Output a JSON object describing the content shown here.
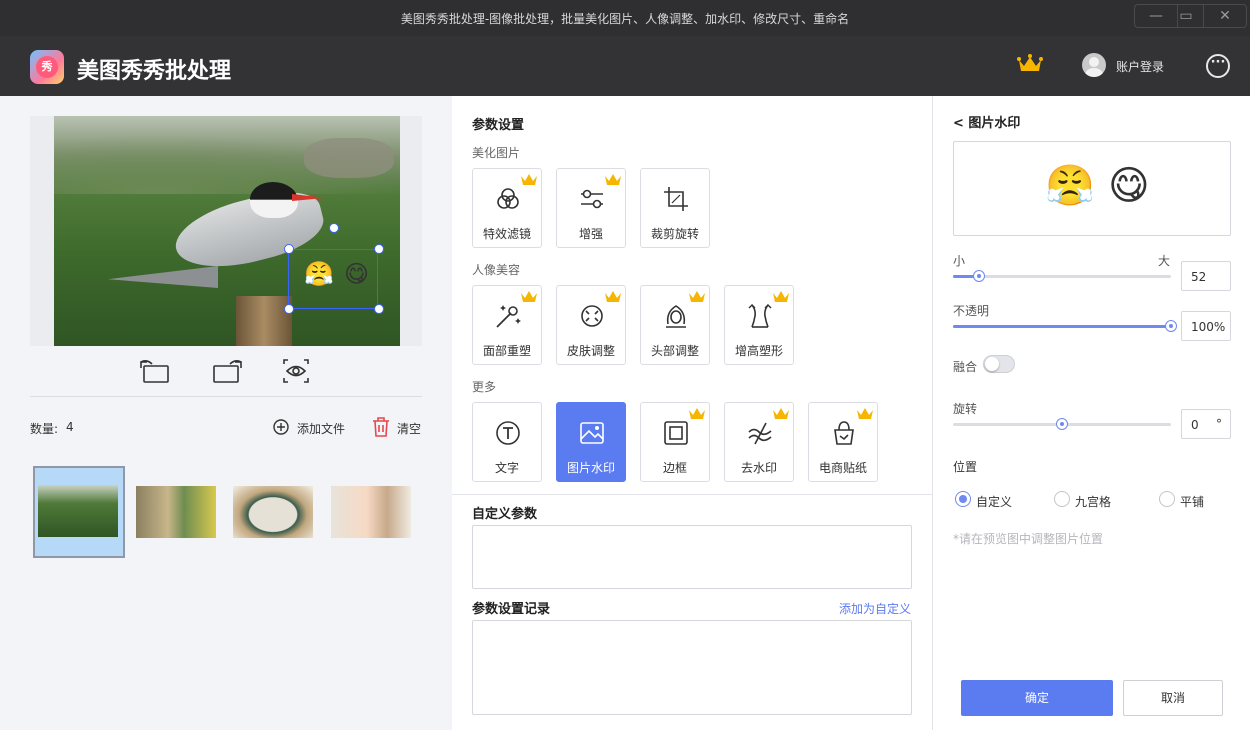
{
  "window": {
    "title": "美图秀秀批处理-图像批处理，批量美化图片、人像调整、加水印、修改尺寸、重命名",
    "min_icon": "minimize-icon",
    "max_icon": "maximize-icon",
    "close_icon": "close-icon",
    "min_glyph": "—",
    "max_glyph": "▭",
    "close_glyph": "✕"
  },
  "header": {
    "app_name": "美图秀秀批处理",
    "logo_text": "秀",
    "account_label": "账户登录",
    "more_glyph": "···",
    "vip_color": "#f6b500"
  },
  "preview": {
    "watermark_emojis": [
      "😤",
      "😋"
    ]
  },
  "files": {
    "count_label": "数量:",
    "count_value": "4",
    "add_label": "添加文件",
    "clear_label": "清空"
  },
  "params": {
    "title": "参数设置",
    "groups": [
      {
        "label": "美化图片",
        "tools": [
          {
            "label": "特效滤镜",
            "icon": "filter-icon",
            "vip": true
          },
          {
            "label": "增强",
            "icon": "adjust-icon",
            "vip": true
          },
          {
            "label": "裁剪旋转",
            "icon": "crop-icon",
            "vip": false
          }
        ]
      },
      {
        "label": "人像美容",
        "tools": [
          {
            "label": "面部重塑",
            "icon": "magic-wand-icon",
            "vip": true
          },
          {
            "label": "皮肤调整",
            "icon": "skin-icon",
            "vip": true
          },
          {
            "label": "头部调整",
            "icon": "head-icon",
            "vip": true
          },
          {
            "label": "增高塑形",
            "icon": "body-shape-icon",
            "vip": true
          }
        ]
      },
      {
        "label": "更多",
        "tools": [
          {
            "label": "文字",
            "icon": "text-icon",
            "vip": false
          },
          {
            "label": "图片水印",
            "icon": "image-watermark-icon",
            "vip": false,
            "active": true
          },
          {
            "label": "边框",
            "icon": "frame-icon",
            "vip": true
          },
          {
            "label": "去水印",
            "icon": "remove-watermark-icon",
            "vip": true
          },
          {
            "label": "电商贴纸",
            "icon": "shopping-sticker-icon",
            "vip": true
          }
        ]
      }
    ],
    "custom_title": "自定义参数",
    "record_title": "参数设置记录",
    "add_custom_link": "添加为自定义",
    "accent_color": "#5b7bf0"
  },
  "watermark_panel": {
    "title": "< 图片水印",
    "preview_emojis": [
      "😤",
      "😋"
    ],
    "size_min_label": "小",
    "size_max_label": "大",
    "size_value": "52",
    "size_fraction": 0.12,
    "opacity_label": "不透明",
    "opacity_value": "100%",
    "opacity_fraction": 1.0,
    "blend_label": "融合",
    "blend_on": false,
    "rotate_label": "旋转",
    "rotate_value": "0",
    "rotate_unit": "°",
    "rotate_fraction": 0.5,
    "position_label": "位置",
    "position_options": [
      "自定义",
      "九宫格",
      "平铺"
    ],
    "position_selected": "自定义",
    "hint": "*请在预览图中调整图片位置",
    "ok_label": "确定",
    "cancel_label": "取消"
  }
}
